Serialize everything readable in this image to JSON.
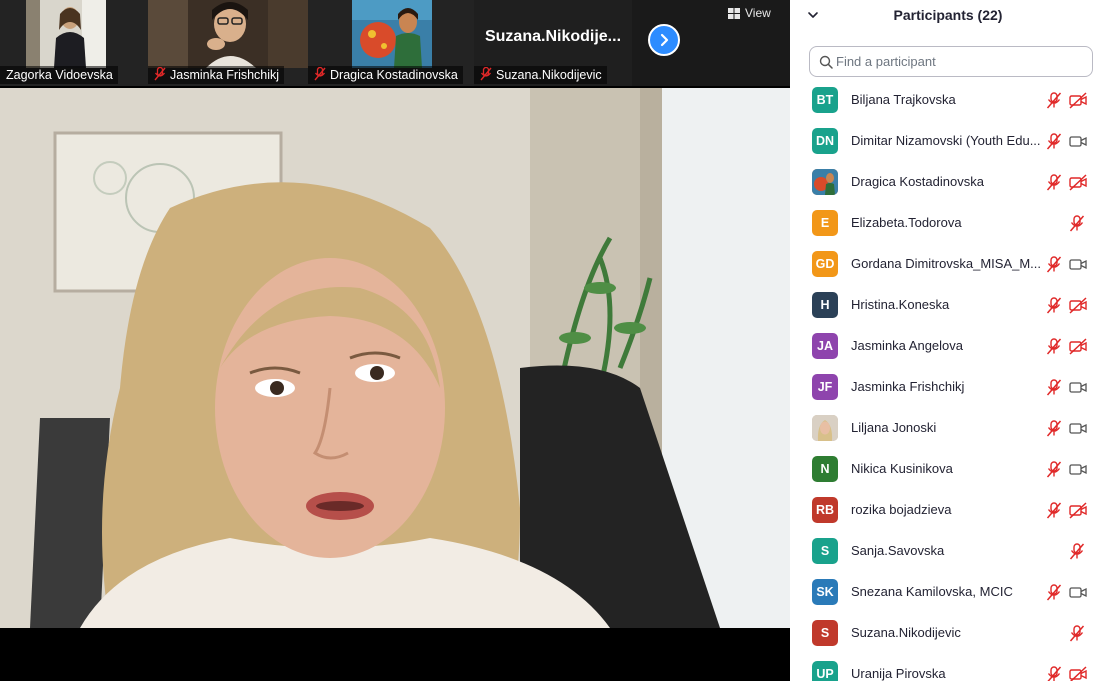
{
  "thumbnails": [
    {
      "name": "Zagorka Vidoevska",
      "muted": false
    },
    {
      "name": "Jasminka Frishchikj",
      "muted": true
    },
    {
      "name": "Dragica Kostadinovska",
      "muted": true
    },
    {
      "name": "Suzana.Nikodijevic",
      "muted": true,
      "big_name": "Suzana.Nikodije..."
    }
  ],
  "view_button": {
    "label": "View",
    "icon": "grid-icon"
  },
  "next_button": {
    "icon": "chevron-right-icon"
  },
  "panel": {
    "title": "Participants (22)",
    "search_placeholder": "Find a participant"
  },
  "participants": [
    {
      "initials": "BT",
      "name": "Biljana Trajkovska",
      "color": "#19a28c",
      "mic": "muted",
      "cam": "off"
    },
    {
      "initials": "DN",
      "name": "Dimitar Nizamovski (Youth Edu...",
      "color": "#19a28c",
      "mic": "muted",
      "cam": "on"
    },
    {
      "initials": "",
      "photo": "photo-dragica",
      "name": "Dragica Kostadinovska",
      "color": "#c86f42",
      "mic": "muted",
      "cam": "off"
    },
    {
      "initials": "E",
      "name": "Elizabeta.Todorova",
      "color": "#f29718",
      "mic": "muted",
      "cam": "none"
    },
    {
      "initials": "GD",
      "name": "Gordana Dimitrovska_MISA_M...",
      "color": "#f29718",
      "mic": "muted",
      "cam": "on"
    },
    {
      "initials": "H",
      "name": "Hristina.Koneska",
      "color": "#2b4157",
      "mic": "muted",
      "cam": "off"
    },
    {
      "initials": "JA",
      "name": "Jasminka Angelova",
      "color": "#8e44ad",
      "mic": "muted",
      "cam": "off"
    },
    {
      "initials": "JF",
      "name": "Jasminka Frishchikj",
      "color": "#8e44ad",
      "mic": "muted",
      "cam": "on"
    },
    {
      "initials": "",
      "photo": "photo-liljana",
      "name": "Liljana Jonoski",
      "color": "#c7b5a0",
      "mic": "muted",
      "cam": "on"
    },
    {
      "initials": "N",
      "name": "Nikica Kusinikova",
      "color": "#2e7d32",
      "mic": "muted",
      "cam": "on"
    },
    {
      "initials": "RB",
      "name": "rozika bojadzieva",
      "color": "#c0392b",
      "mic": "muted",
      "cam": "off"
    },
    {
      "initials": "S",
      "name": "Sanja.Savovska",
      "color": "#19a28c",
      "mic": "muted",
      "cam": "none"
    },
    {
      "initials": "SK",
      "name": "Snezana Kamilovska, MCIC",
      "color": "#2a7ab8",
      "mic": "muted",
      "cam": "on"
    },
    {
      "initials": "S",
      "name": "Suzana.Nikodijevic",
      "color": "#c0392b",
      "mic": "muted",
      "cam": "none"
    },
    {
      "initials": "UP",
      "name": "Uranija Pirovska",
      "color": "#19a28c",
      "mic": "muted",
      "cam": "off"
    }
  ]
}
